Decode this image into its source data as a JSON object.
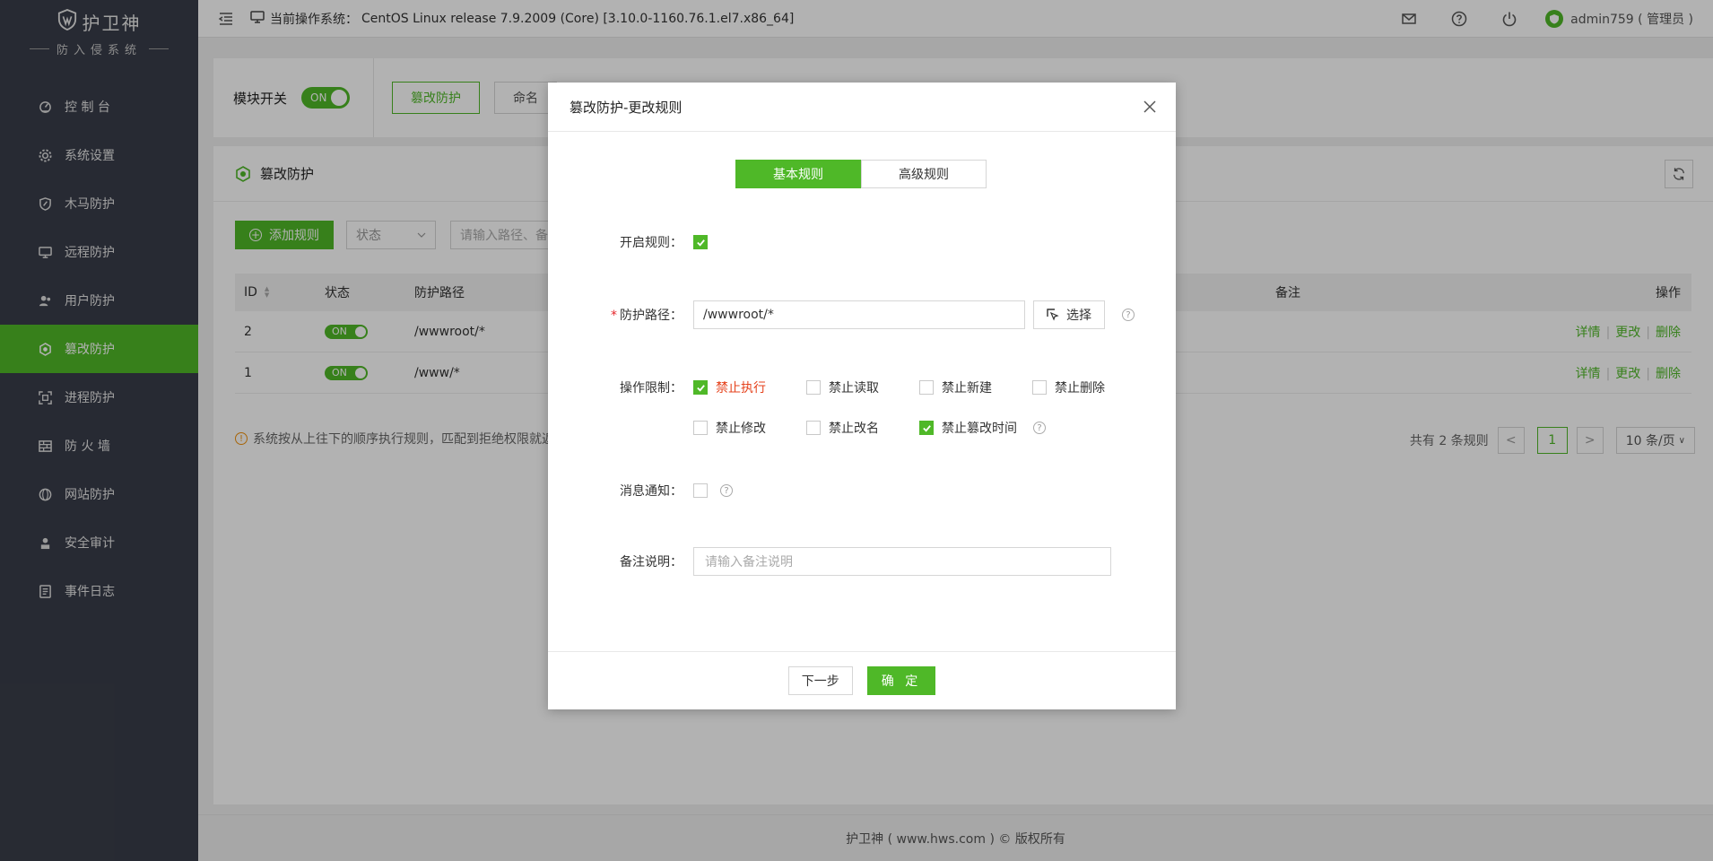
{
  "brand": {
    "title": "护卫神",
    "subtitle": "防入侵系统"
  },
  "sidebar": {
    "items": [
      {
        "label": "控 制 台",
        "icon": "dashboard-icon"
      },
      {
        "label": "系统设置",
        "icon": "gear-icon"
      },
      {
        "label": "木马防护",
        "icon": "shield-icon"
      },
      {
        "label": "远程防护",
        "icon": "monitor-icon"
      },
      {
        "label": "用户防护",
        "icon": "users-icon"
      },
      {
        "label": "篡改防护",
        "icon": "hexagon-shield-icon",
        "active": true
      },
      {
        "label": "进程防护",
        "icon": "scan-icon"
      },
      {
        "label": "防 火 墙",
        "icon": "firewall-icon"
      },
      {
        "label": "网站防护",
        "icon": "globe-icon"
      },
      {
        "label": "安全审计",
        "icon": "audit-icon"
      },
      {
        "label": "事件日志",
        "icon": "log-icon"
      }
    ]
  },
  "topbar": {
    "os_label": "当前操作系统：",
    "os_value": "CentOS Linux release 7.9.2009 (Core) [3.10.0-1160.76.1.el7.x86_64]",
    "user": "admin759 ( 管理员 )"
  },
  "module": {
    "label": "模块开关",
    "switch": "ON",
    "tabs": [
      "篡改防护",
      "命名"
    ]
  },
  "panel": {
    "title": "篡改防护",
    "add_button": "添加规则",
    "status_placeholder": "状态",
    "search_placeholder": "请输入路径、备",
    "columns": {
      "id": "ID",
      "status": "状态",
      "path": "防护路径",
      "note": "备注",
      "op": "操作"
    },
    "rows": [
      {
        "id": "2",
        "status": "ON",
        "path": "/wwwroot/*"
      },
      {
        "id": "1",
        "status": "ON",
        "path": "/www/*"
      }
    ],
    "row_actions": {
      "detail": "详情",
      "edit": "更改",
      "delete": "删除"
    },
    "tip": "系统按从上往下的顺序执行规则，匹配到拒绝权限就返",
    "pagination": {
      "total": "共有 2 条规则",
      "current": "1",
      "page_size": "10 条/页"
    }
  },
  "footer": "护卫神 ( www.hws.com ) © 版权所有",
  "modal": {
    "title": "篡改防护-更改规则",
    "tabs": [
      "基本规则",
      "高级规则"
    ],
    "enable_label": "开启规则：",
    "enable_checked": true,
    "path_label": "防护路径：",
    "path_value": "/wwwroot/*",
    "choose_button": "选择",
    "ops_label": "操作限制：",
    "ops": [
      {
        "label": "禁止执行",
        "checked": true
      },
      {
        "label": "禁止读取",
        "checked": false
      },
      {
        "label": "禁止新建",
        "checked": false
      },
      {
        "label": "禁止删除",
        "checked": false
      },
      {
        "label": "禁止修改",
        "checked": false
      },
      {
        "label": "禁止改名",
        "checked": false
      },
      {
        "label": "禁止篡改时间",
        "checked": true
      }
    ],
    "notify_label": "消息通知：",
    "notify_checked": false,
    "note_label": "备注说明：",
    "note_placeholder": "请输入备注说明",
    "next_button": "下一步",
    "ok_button": "确 定"
  },
  "colors": {
    "accent": "#4fb828",
    "sidebar_bg": "#393d49",
    "danger": "#e5421c"
  }
}
